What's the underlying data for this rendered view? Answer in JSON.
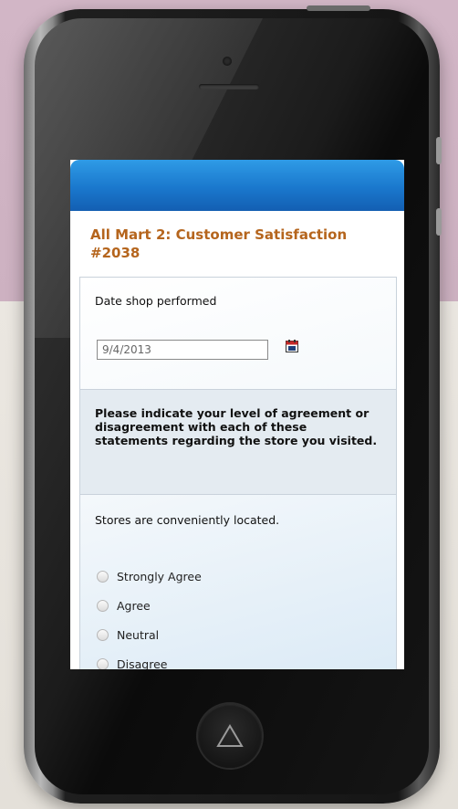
{
  "form": {
    "title": "All Mart 2: Customer Satisfaction #2038",
    "date_label": "Date shop performed",
    "date_value": "9/4/2013",
    "instructions": "Please indicate your level of agreement or disagreement with each of these statements regarding the store you visited.",
    "question": "Stores are conveniently located.",
    "options": [
      "Strongly Agree",
      "Agree",
      "Neutral",
      "Disagree"
    ]
  },
  "icons": {
    "calendar": "calendar-icon",
    "home": "home-triangle-icon"
  },
  "colors": {
    "title": "#b5651d",
    "header_bar": "#1a78cd"
  }
}
